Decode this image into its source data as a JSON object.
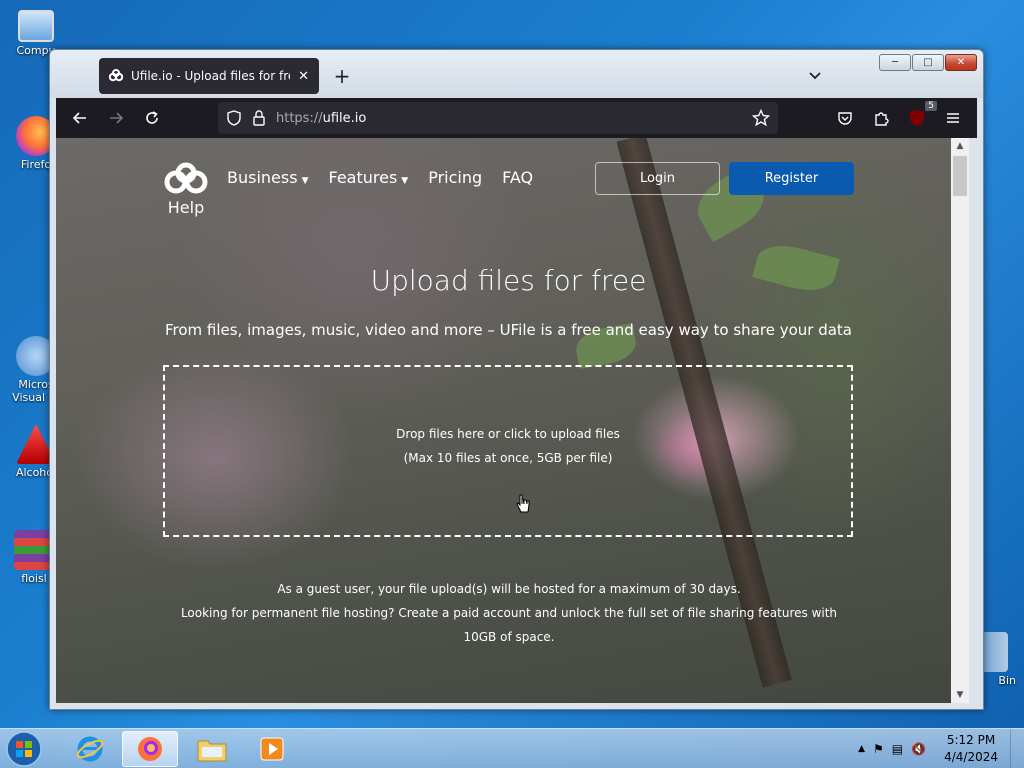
{
  "desktop": {
    "icons": [
      {
        "label": "Compu",
        "icon": "computer-icon"
      },
      {
        "label": "Firefo",
        "icon": "firefox-icon"
      },
      {
        "label": "Micros",
        "label2": "Visual St",
        "icon": "visual-studio-icon"
      },
      {
        "label": "Alcohol",
        "icon": "alcohol-icon"
      },
      {
        "label": "floisl",
        "icon": "winrar-icon"
      },
      {
        "label": "Bin",
        "icon": "recycle-bin-icon"
      }
    ]
  },
  "browser": {
    "tab": {
      "title": "Ufile.io - Upload files for free &",
      "favicon": "ufile-logo-icon"
    },
    "url": {
      "scheme": "https://",
      "host": "ufile.io"
    },
    "ublock_count": "5"
  },
  "site": {
    "logo_text": "Help",
    "nav": [
      {
        "label": "Business",
        "dropdown": true
      },
      {
        "label": "Features",
        "dropdown": true
      },
      {
        "label": "Pricing",
        "dropdown": false
      },
      {
        "label": "FAQ",
        "dropdown": false
      }
    ],
    "login": "Login",
    "register": "Register",
    "hero_title": "Upload files for free",
    "hero_subtitle": "From files, images, music, video and more – UFile is a free and easy way to share your data",
    "dropzone_line1": "Drop files here or click to upload files",
    "dropzone_line2": "(Max 10 files at once, 5GB per file)",
    "guest_line1": "As a guest user, your file upload(s) will be hosted for a maximum of 30 days.",
    "guest_line2": "Looking for permanent file hosting? Create a paid account and unlock the full set of file sharing features with 10GB of space."
  },
  "taskbar": {
    "time": "5:12 PM",
    "date": "4/4/2024"
  },
  "colors": {
    "register": "#0a5bb0",
    "toolbar": "#1c1b22"
  }
}
